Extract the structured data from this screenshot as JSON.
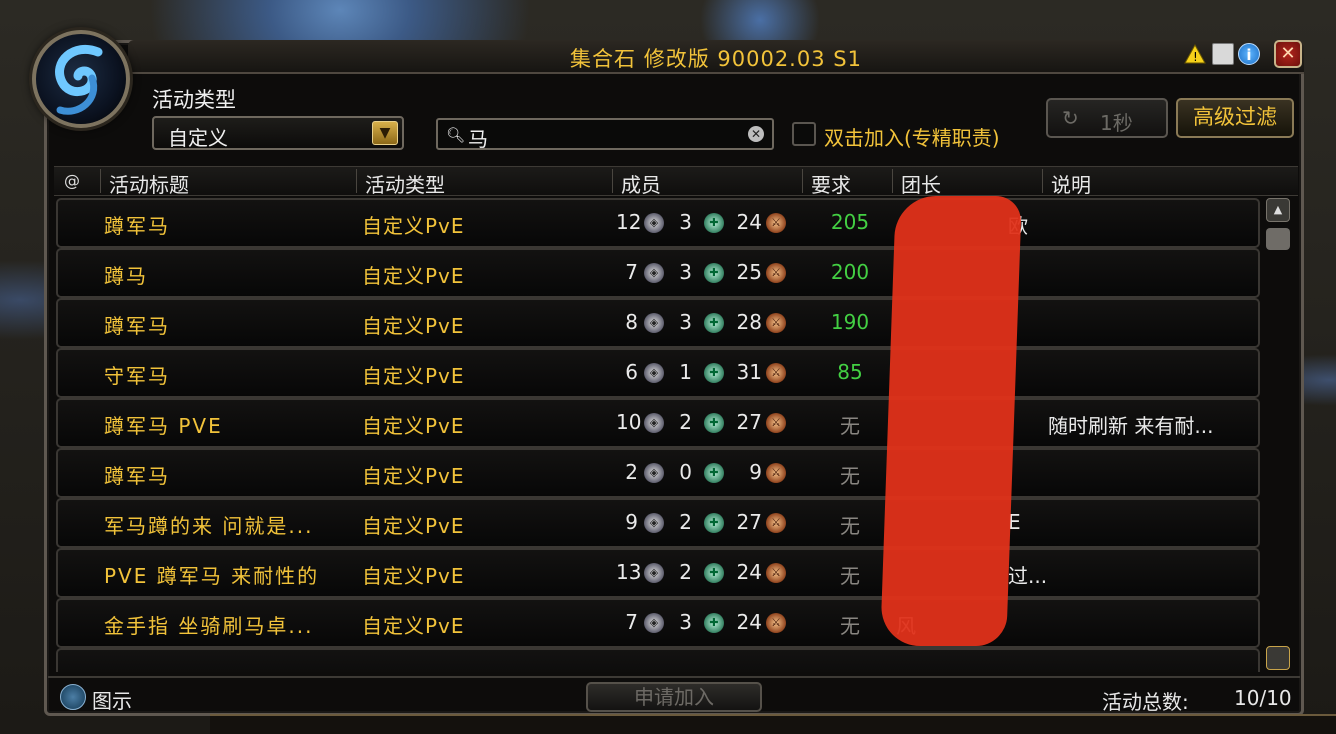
{
  "window": {
    "title": "集合石 修改版 90002.03 S1"
  },
  "icons": {
    "portrait": "meeting-stone-portrait",
    "warn": "warning-icon",
    "doc": "document-icon",
    "info": "info-icon",
    "close": "close-icon"
  },
  "filters": {
    "type_label": "活动类型",
    "type_value": "自定义",
    "search_value": "马",
    "double_click_label": "双击加入(专精职责)",
    "refresh_label": "1秒",
    "advanced_filter_label": "高级过滤"
  },
  "columns": {
    "at": "@",
    "title": "活动标题",
    "type": "活动类型",
    "members": "成员",
    "req": "要求",
    "leader": "团长",
    "desc": "说明"
  },
  "rows": [
    {
      "title": "蹲军马",
      "type": "自定义PvE",
      "tank": "12",
      "heal": "3",
      "dps": "24",
      "req": "205",
      "req_color": "#43d043",
      "leader": "",
      "leader_tail": "欧",
      "desc": ""
    },
    {
      "title": "蹲马",
      "type": "自定义PvE",
      "tank": "7",
      "heal": "3",
      "dps": "25",
      "req": "200",
      "req_color": "#43d043",
      "leader": "",
      "leader_tail": "",
      "desc": ""
    },
    {
      "title": "蹲军马",
      "type": "自定义PvE",
      "tank": "8",
      "heal": "3",
      "dps": "28",
      "req": "190",
      "req_color": "#43d043",
      "leader": "",
      "leader_tail": "",
      "desc": ""
    },
    {
      "title": "守军马",
      "type": "自定义PvE",
      "tank": "6",
      "heal": "1",
      "dps": "31",
      "req": "85",
      "req_color": "#43d043",
      "leader": "",
      "leader_tail": "",
      "desc": ""
    },
    {
      "title": "蹲军马 PVE",
      "type": "自定义PvE",
      "tank": "10",
      "heal": "2",
      "dps": "27",
      "req": "无",
      "req_color": "#8a8782",
      "leader": "",
      "leader_tail": "",
      "desc": "随时刷新 来有耐..."
    },
    {
      "title": "蹲军马",
      "type": "自定义PvE",
      "tank": "2",
      "heal": "0",
      "dps": "9",
      "req": "无",
      "req_color": "#8a8782",
      "leader": "",
      "leader_tail": "",
      "desc": ""
    },
    {
      "title": "军马蹲的来 问就是...",
      "type": "自定义PvE",
      "tank": "9",
      "heal": "2",
      "dps": "27",
      "req": "无",
      "req_color": "#8a8782",
      "leader": "",
      "leader_tail": "E",
      "desc": ""
    },
    {
      "title": "PVE 蹲军马 来耐性的",
      "type": "自定义PvE",
      "tank": "13",
      "heal": "2",
      "dps": "24",
      "req": "无",
      "req_color": "#8a8782",
      "leader": "",
      "leader_tail": "过...",
      "desc": ""
    },
    {
      "title": "金手指 坐骑刷马卓...",
      "type": "自定义PvE",
      "tank": "7",
      "heal": "3",
      "dps": "24",
      "req": "无",
      "req_color": "#8a8782",
      "leader": "风",
      "leader_tail": "",
      "desc": ""
    },
    {
      "title": "",
      "type": "",
      "tank": "",
      "heal": "",
      "dps": "",
      "req": "",
      "req_color": "#8a8782",
      "leader": "",
      "leader_tail": "",
      "desc": ""
    }
  ],
  "footer": {
    "legend_label": "图示",
    "apply_label": "申请加入",
    "total_label": "活动总数:",
    "total_value": "10/10"
  }
}
